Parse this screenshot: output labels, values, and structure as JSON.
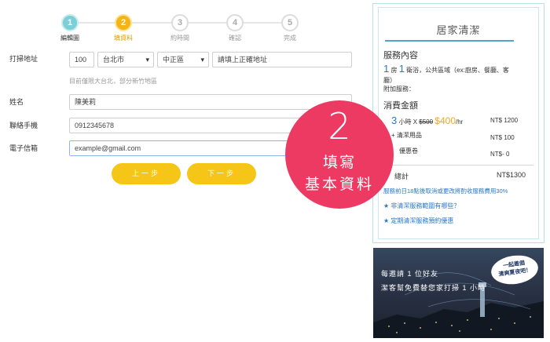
{
  "stepper": {
    "steps": [
      {
        "num": "1",
        "label": "編輯圖",
        "state": "done"
      },
      {
        "num": "2",
        "label": "填資料",
        "state": "active"
      },
      {
        "num": "3",
        "label": "約時間",
        "state": "todo"
      },
      {
        "num": "4",
        "label": "確認",
        "state": "todo"
      },
      {
        "num": "5",
        "label": "完成",
        "state": "todo"
      }
    ]
  },
  "form": {
    "address": {
      "label": "打掃地址",
      "zip": "100",
      "city": "台北市",
      "district": "中正區",
      "street_placeholder": "請填上正確地址",
      "hint": "目前僅限大台北，部分新竹地區"
    },
    "name": {
      "label": "姓名",
      "value": "陳美莉"
    },
    "phone": {
      "label": "聯絡手機",
      "value": "0912345678"
    },
    "email": {
      "label": "電子信箱",
      "value": "example@gmail.com"
    },
    "prev_label": "上一步",
    "next_label": "下一步"
  },
  "panel": {
    "title": "居家清潔",
    "service_heading": "服務內容",
    "rooms_num": "1",
    "rooms_unit": "房",
    "baths_num": "1",
    "baths_unit": "衛浴，公共區域（ex:廚房、餐廳、客",
    "baths_unit_cont": "廳）",
    "extras_label": "附加服務：",
    "amount_heading": "消費金額",
    "hours_num": "3",
    "hours_unit": "小時 X",
    "old_price": "$500",
    "new_price": "$400",
    "per_hour": "/hr",
    "line1_amount": "NT$ 1200",
    "line2_label": "+ 清潔用品",
    "line2_amount": "NT$ 100",
    "line3_label": "優惠卷",
    "line3_amount": "NT$- 0",
    "total_label": "總計",
    "total_amount": "NT$1300",
    "links": [
      "服務前日18點後取消或更改將酌收服務費用30%",
      "★ 非清潔服務範圍有哪些？",
      "★ 定期清潔服務預約優惠"
    ]
  },
  "promo": {
    "line1": "每邀請 1 位好友",
    "line2": "潔客幫免費替您家打掃 1 小時",
    "bubble1": "一起邀個",
    "bubble2": "清爽夏夜吧！"
  },
  "badge": {
    "num": "2",
    "line1": "填寫",
    "line2": "基本資料"
  },
  "colors": {
    "accent": "#f5c518",
    "step_done": "#7ccfd8",
    "badge": "#ec3a63",
    "link": "#2a78c8"
  }
}
